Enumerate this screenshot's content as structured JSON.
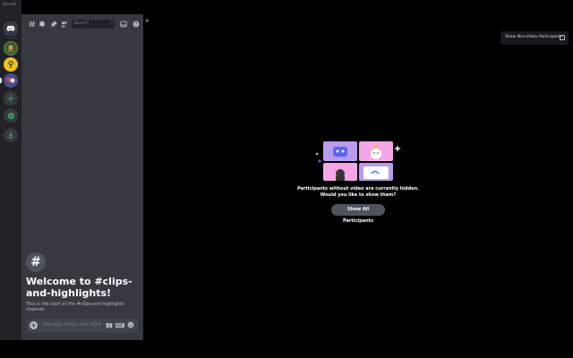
{
  "rail": {
    "label": "Discord",
    "servers": [
      {
        "name": "home",
        "icon": "discord-logo-icon"
      },
      {
        "name": "server-1"
      },
      {
        "name": "server-2"
      },
      {
        "name": "server-3"
      }
    ],
    "add_icon": "+",
    "explore_icon": "compass-icon",
    "download_icon": "download-icon"
  },
  "toolbar": {
    "search_placeholder": "Search",
    "search_icon": "⌕"
  },
  "welcome": {
    "hash": "#",
    "title": "Welcome to #clips-and-highlights!",
    "subtitle": "This is the start of the #clips-and-highlights channel."
  },
  "composer": {
    "placeholder": "Message #clips-and-highli...",
    "gif_label": "GIF"
  },
  "stage": {
    "nonvideo_label": "Show Non-Video Participants",
    "hidden_line1": "Participants without video are currently hidden.",
    "hidden_line2": "Would you like to show them?",
    "show_all_label": "Show All Participants"
  },
  "colors": {
    "rail_bg": "#202225",
    "chat_bg": "#36393f",
    "green": "#3ba55d",
    "stage_bg": "#000000"
  }
}
